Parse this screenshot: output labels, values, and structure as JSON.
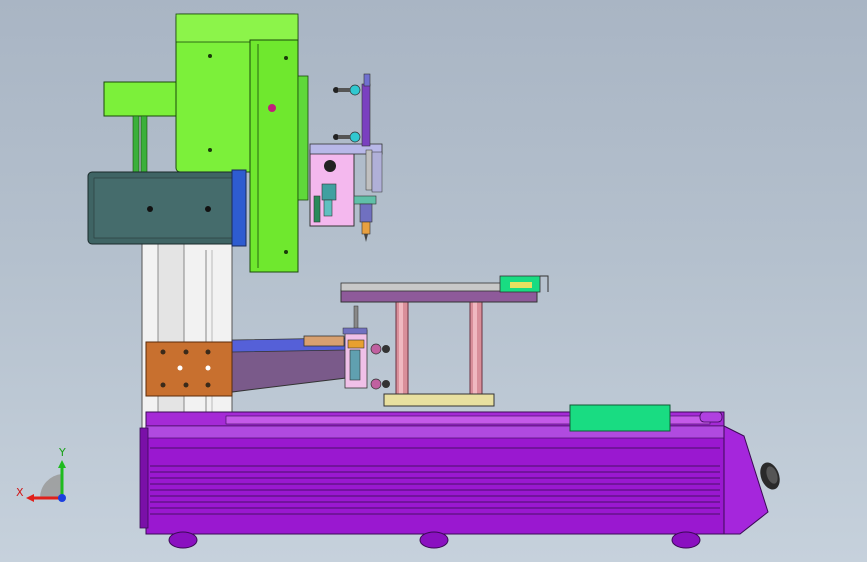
{
  "triad": {
    "x_label": "X",
    "y_label": "Y"
  },
  "colors": {
    "background": "#b4c0cd",
    "base": "#9e1bd6",
    "gantry": "#7cf03a",
    "cover": "#3f6464",
    "bracket": "#c9702f",
    "carriage": "#f3b8ef",
    "platen": "#8e5a9a",
    "posts": "#d98f9a",
    "table_green": "#19dc82",
    "axis_red": "#e0201b",
    "axis_green": "#1fbb1f",
    "axis_blue": "#1b3fe0"
  }
}
